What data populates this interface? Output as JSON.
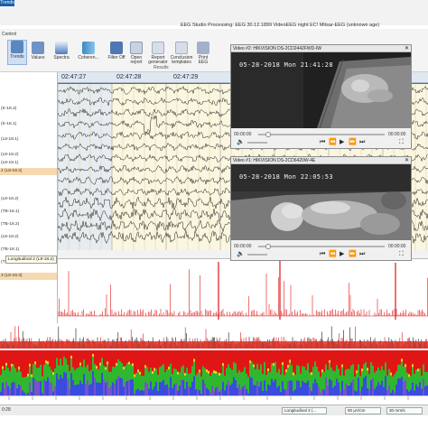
{
  "app": {
    "trends_tab": "Trends",
    "window_title": "EEG Studio Processing: EEG 30.12.1899 VideoEEG night EC! Mitsar-EEG (unknown age)"
  },
  "ribbon": {
    "group_control": "Control",
    "group_results": "Results",
    "buttons": [
      {
        "label": "Trends",
        "icon": "trends-icon"
      },
      {
        "label": "Values",
        "icon": "values-icon"
      },
      {
        "label": "Spectra",
        "icon": "spectra-icon"
      },
      {
        "label": "Coheren...",
        "icon": "coherence-icon"
      },
      {
        "label": "Filter Off",
        "icon": "filter-icon"
      },
      {
        "label": "Open report",
        "icon": "open-report-icon"
      },
      {
        "label": "Report generator",
        "icon": "report-generator-icon"
      },
      {
        "label": "Conclusion templates",
        "icon": "conclusion-templates-icon"
      },
      {
        "label": "Print EEG",
        "icon": "print-icon"
      }
    ]
  },
  "timeline": {
    "labels": [
      "02:47:27",
      "02:47:28",
      "02:47:29"
    ]
  },
  "channels": [
    "(K-18.2)",
    "(K-18.1)",
    "(L8-18.1)",
    "(L8-18.2)",
    "(L8-18.1)",
    "2 (L8-18.2)",
    "(L8-18.2)",
    "(TB-18.1)",
    "(TB-18.2)",
    "(L8-18.2)",
    "(TB-18.1)",
    "(TB-18.2)"
  ],
  "highlighted_channel": "3 (L8-18.3)",
  "tooltip": "Longitudinal 2 (L8-18.2)",
  "montage_label": "al Montage",
  "videos": [
    {
      "title": "Video #2: HIKVISION DS-2CD2442FWD-IW",
      "osd": "05-28-2018 Mon 21:41:28",
      "time_start": "00:00:00",
      "time_end": "00:00:00",
      "progress": 0.08
    },
    {
      "title": "Video #1: HIKVISION DS-2CD6420W-4E",
      "osd": "05-28-2018 Mon 22:05:53",
      "time_start": "00:00:00",
      "time_end": "00:00:00",
      "progress": 0.08
    }
  ],
  "status": {
    "time": "0:28",
    "montage": "Longitudinal 3 (...",
    "sensitivity": "50 µV/cm",
    "speed": "30 mm/s"
  },
  "colors": {
    "ribbon_accent": "#1c5fa8",
    "eeg_background": "#fbf6df",
    "trace": "#1a1a1a",
    "highlight": "#f7d9b0",
    "spectral_high": "#e01616",
    "spectral_mid": "#2fb82f",
    "spectral_low": "#3a4be0"
  }
}
